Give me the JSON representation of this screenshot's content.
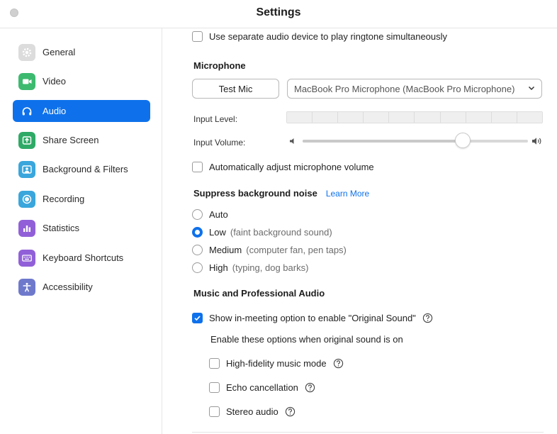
{
  "window": {
    "title": "Settings"
  },
  "sidebar": {
    "items": [
      {
        "label": "General",
        "icon": "gear-icon",
        "color": "#d9d9d9"
      },
      {
        "label": "Video",
        "icon": "video-camera-icon",
        "color": "#3cb371"
      },
      {
        "label": "Audio",
        "icon": "headphones-icon",
        "color": "#0e71eb",
        "active": true
      },
      {
        "label": "Share Screen",
        "icon": "share-screen-icon",
        "color": "#2fa866"
      },
      {
        "label": "Background & Filters",
        "icon": "background-icon",
        "color": "#39a4d9"
      },
      {
        "label": "Recording",
        "icon": "recording-icon",
        "color": "#39a4d9"
      },
      {
        "label": "Statistics",
        "icon": "statistics-icon",
        "color": "#8e5bd6"
      },
      {
        "label": "Keyboard Shortcuts",
        "icon": "keyboard-icon",
        "color": "#8e5bd6"
      },
      {
        "label": "Accessibility",
        "icon": "accessibility-icon",
        "color": "#6b77c9"
      }
    ]
  },
  "audio": {
    "separate_ringtone": {
      "label": "Use separate audio device to play ringtone simultaneously",
      "checked": false
    },
    "microphone": {
      "title": "Microphone",
      "test_button": "Test Mic",
      "device": "MacBook Pro Microphone (MacBook Pro Microphone)",
      "input_level_label": "Input Level:",
      "input_volume_label": "Input Volume:",
      "volume_value": 0.71,
      "auto_adjust": {
        "label": "Automatically adjust microphone volume",
        "checked": false
      }
    },
    "noise": {
      "title": "Suppress background noise",
      "learn_more": "Learn More",
      "options": [
        {
          "label": "Auto",
          "desc": "",
          "checked": false
        },
        {
          "label": "Low",
          "desc": "(faint background sound)",
          "checked": true
        },
        {
          "label": "Medium",
          "desc": "(computer fan, pen taps)",
          "checked": false
        },
        {
          "label": "High",
          "desc": "(typing, dog barks)",
          "checked": false
        }
      ]
    },
    "music": {
      "title": "Music and Professional Audio",
      "original_sound": {
        "label": "Show in-meeting option to enable \"Original Sound\"",
        "checked": true
      },
      "enable_note": "Enable these options when original sound is on",
      "options": [
        {
          "label": "High-fidelity music mode",
          "checked": false
        },
        {
          "label": "Echo cancellation",
          "checked": false
        },
        {
          "label": "Stereo audio",
          "checked": false
        }
      ]
    }
  },
  "colors": {
    "accent": "#0e71eb"
  }
}
